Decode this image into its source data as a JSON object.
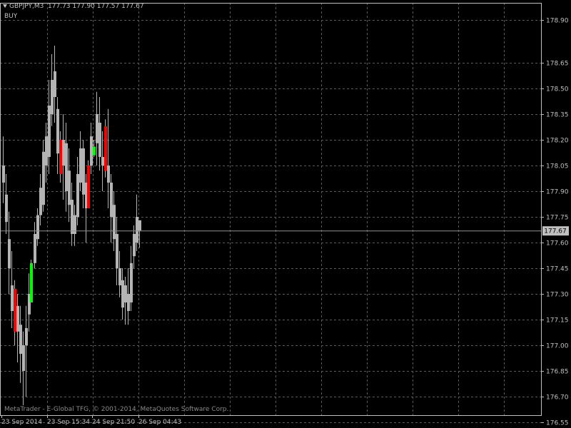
{
  "header": {
    "symbol": "GBPJPY,M3",
    "ohlc": "177.73 177.90 177.57 177.67"
  },
  "signal": "BUY",
  "copyright": "MetaTrader - E-Global TFG, © 2001-2014, MetaQuotes Software Corp.",
  "colors": {
    "background": "#000000",
    "grid": "#5a5a5a",
    "text": "#c0c0c0",
    "bar": "#b4b4b4",
    "bear": "#ff0000",
    "bull": "#00ff00",
    "price_line": "#909090"
  },
  "chart_data": {
    "type": "ohlc",
    "symbol": "GBPJPY",
    "timeframe": "M3",
    "current_price": 177.67,
    "y_ticks": [
      "178.90",
      "178.65",
      "178.50",
      "178.35",
      "178.20",
      "178.05",
      "177.90",
      "177.75",
      "177.60",
      "177.45",
      "177.30",
      "177.15",
      "177.00",
      "176.85",
      "176.70",
      "176.55"
    ],
    "x_ticks": [
      "23 Sep 2014",
      "23 Sep 15:34",
      "24 Sep 21:50",
      "26 Sep 04:43"
    ],
    "grid": true,
    "bars": [
      {
        "x": 4,
        "hi": 178.22,
        "lo": 177.83,
        "o": 177.95,
        "c": 178.05,
        "col": "gray"
      },
      {
        "x": 8,
        "hi": 178.0,
        "lo": 177.65,
        "o": 177.72,
        "c": 177.88,
        "col": "gray"
      },
      {
        "x": 12,
        "hi": 177.78,
        "lo": 177.3,
        "o": 177.62,
        "c": 177.45,
        "col": "gray"
      },
      {
        "x": 16,
        "hi": 177.55,
        "lo": 177.1,
        "o": 177.2,
        "c": 177.35,
        "col": "gray"
      },
      {
        "x": 20,
        "hi": 177.38,
        "lo": 177.0,
        "o": 177.33,
        "c": 177.08,
        "col": "red"
      },
      {
        "x": 24,
        "hi": 177.3,
        "lo": 176.9,
        "o": 177.08,
        "c": 177.23,
        "col": "gray"
      },
      {
        "x": 28,
        "hi": 177.23,
        "lo": 176.78,
        "o": 177.12,
        "c": 176.95,
        "col": "gray"
      },
      {
        "x": 32,
        "hi": 177.08,
        "lo": 176.65,
        "o": 176.85,
        "c": 177.0,
        "col": "gray"
      },
      {
        "x": 36,
        "hi": 177.23,
        "lo": 176.7,
        "o": 177.0,
        "c": 177.1,
        "col": "gray"
      },
      {
        "x": 40,
        "hi": 177.42,
        "lo": 177.08,
        "o": 177.18,
        "c": 177.3,
        "col": "gray"
      },
      {
        "x": 43,
        "hi": 177.5,
        "lo": 177.25,
        "o": 177.25,
        "c": 177.48,
        "col": "green"
      },
      {
        "x": 48,
        "hi": 177.72,
        "lo": 177.45,
        "o": 177.48,
        "c": 177.65,
        "col": "gray"
      },
      {
        "x": 52,
        "hi": 177.8,
        "lo": 177.58,
        "o": 177.62,
        "c": 177.76,
        "col": "gray"
      },
      {
        "x": 56,
        "hi": 178.0,
        "lo": 177.7,
        "o": 177.76,
        "c": 177.92,
        "col": "gray"
      },
      {
        "x": 60,
        "hi": 178.2,
        "lo": 177.78,
        "o": 177.82,
        "c": 178.13,
        "col": "gray"
      },
      {
        "x": 64,
        "hi": 178.3,
        "lo": 177.95,
        "o": 178.05,
        "c": 178.22,
        "col": "gray"
      },
      {
        "x": 68,
        "hi": 178.55,
        "lo": 178.0,
        "o": 178.1,
        "c": 178.4,
        "col": "gray"
      },
      {
        "x": 72,
        "hi": 178.7,
        "lo": 178.28,
        "o": 178.35,
        "c": 178.55,
        "col": "gray"
      },
      {
        "x": 76,
        "hi": 178.75,
        "lo": 178.3,
        "o": 178.6,
        "c": 178.45,
        "col": "gray"
      },
      {
        "x": 80,
        "hi": 178.45,
        "lo": 178.0,
        "o": 178.38,
        "c": 178.12,
        "col": "gray"
      },
      {
        "x": 84,
        "hi": 178.25,
        "lo": 177.95,
        "o": 178.2,
        "c": 178.0,
        "col": "red"
      },
      {
        "x": 88,
        "hi": 178.35,
        "lo": 177.85,
        "o": 178.05,
        "c": 178.2,
        "col": "gray"
      },
      {
        "x": 92,
        "hi": 178.3,
        "lo": 177.78,
        "o": 178.18,
        "c": 177.9,
        "col": "gray"
      },
      {
        "x": 96,
        "hi": 178.15,
        "lo": 177.72,
        "o": 178.02,
        "c": 177.82,
        "col": "gray"
      },
      {
        "x": 100,
        "hi": 177.95,
        "lo": 177.58,
        "o": 177.85,
        "c": 177.65,
        "col": "gray"
      },
      {
        "x": 104,
        "hi": 177.82,
        "lo": 177.58,
        "o": 177.65,
        "c": 177.76,
        "col": "gray"
      },
      {
        "x": 108,
        "hi": 178.1,
        "lo": 177.7,
        "o": 177.75,
        "c": 178.0,
        "col": "gray"
      },
      {
        "x": 112,
        "hi": 178.25,
        "lo": 177.9,
        "o": 177.95,
        "c": 178.15,
        "col": "gray"
      },
      {
        "x": 116,
        "hi": 178.2,
        "lo": 177.8,
        "o": 178.15,
        "c": 177.88,
        "col": "gray"
      },
      {
        "x": 120,
        "hi": 178.0,
        "lo": 177.6,
        "o": 177.95,
        "c": 177.8,
        "col": "gray"
      },
      {
        "x": 123,
        "hi": 178.08,
        "lo": 177.8,
        "o": 178.05,
        "c": 177.8,
        "col": "red"
      },
      {
        "x": 127,
        "hi": 178.3,
        "lo": 178.0,
        "o": 178.05,
        "c": 178.22,
        "col": "gray"
      },
      {
        "x": 131,
        "hi": 178.2,
        "lo": 178.1,
        "o": 178.11,
        "c": 178.16,
        "col": "green"
      },
      {
        "x": 135,
        "hi": 178.48,
        "lo": 178.05,
        "o": 178.18,
        "c": 178.35,
        "col": "gray"
      },
      {
        "x": 139,
        "hi": 178.45,
        "lo": 178.02,
        "o": 178.3,
        "c": 178.1,
        "col": "gray"
      },
      {
        "x": 143,
        "hi": 178.25,
        "lo": 177.9,
        "o": 178.1,
        "c": 178.05,
        "col": "gray"
      },
      {
        "x": 147,
        "hi": 178.32,
        "lo": 177.98,
        "o": 178.28,
        "c": 178.02,
        "col": "red"
      },
      {
        "x": 151,
        "hi": 178.38,
        "lo": 177.8,
        "o": 178.05,
        "c": 177.95,
        "col": "gray"
      },
      {
        "x": 155,
        "hi": 178.0,
        "lo": 177.6,
        "o": 177.95,
        "c": 177.75,
        "col": "gray"
      },
      {
        "x": 159,
        "hi": 177.9,
        "lo": 177.55,
        "o": 177.82,
        "c": 177.62,
        "col": "gray"
      },
      {
        "x": 163,
        "hi": 177.75,
        "lo": 177.35,
        "o": 177.65,
        "c": 177.45,
        "col": "gray"
      },
      {
        "x": 167,
        "hi": 177.55,
        "lo": 177.28,
        "o": 177.45,
        "c": 177.35,
        "col": "gray"
      },
      {
        "x": 171,
        "hi": 177.45,
        "lo": 177.15,
        "o": 177.38,
        "c": 177.22,
        "col": "gray"
      },
      {
        "x": 175,
        "hi": 177.4,
        "lo": 177.12,
        "o": 177.25,
        "c": 177.35,
        "col": "gray"
      },
      {
        "x": 179,
        "hi": 177.45,
        "lo": 177.12,
        "o": 177.3,
        "c": 177.2,
        "col": "gray"
      },
      {
        "x": 183,
        "hi": 177.58,
        "lo": 177.2,
        "o": 177.25,
        "c": 177.48,
        "col": "gray"
      },
      {
        "x": 187,
        "hi": 177.7,
        "lo": 177.45,
        "o": 177.52,
        "c": 177.65,
        "col": "gray"
      },
      {
        "x": 191,
        "hi": 177.88,
        "lo": 177.55,
        "o": 177.6,
        "c": 177.75,
        "col": "gray"
      },
      {
        "x": 195,
        "hi": 177.73,
        "lo": 177.57,
        "o": 177.73,
        "c": 177.67,
        "col": "gray"
      }
    ]
  }
}
